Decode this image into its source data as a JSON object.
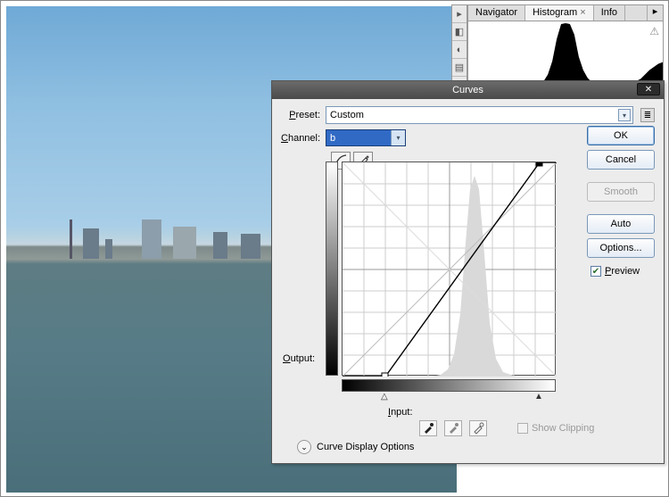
{
  "panels": {
    "tabs": {
      "navigator": "Navigator",
      "histogram": "Histogram",
      "info": "Info",
      "active": "Histogram"
    }
  },
  "dialog": {
    "title": "Curves",
    "preset_label": "Preset:",
    "preset_value": "Custom",
    "channel_label": "Channel:",
    "channel_value": "b",
    "output_label": "Output:",
    "input_label": "Input:",
    "show_clipping_label": "Show Clipping",
    "curve_display_options": "Curve Display Options",
    "buttons": {
      "ok": "OK",
      "cancel": "Cancel",
      "smooth": "Smooth",
      "auto": "Auto",
      "options": "Options..."
    },
    "preview_label": "Preview",
    "preview_checked": true
  },
  "chart_data": {
    "type": "line",
    "title": "Curves",
    "xlabel": "Input",
    "ylabel": "Output",
    "xlim": [
      0,
      255
    ],
    "ylim": [
      0,
      255
    ],
    "grid": true,
    "series": [
      {
        "name": "baseline",
        "x": [
          0,
          255
        ],
        "y": [
          0,
          255
        ]
      },
      {
        "name": "curve",
        "x": [
          0,
          51,
          235,
          255
        ],
        "y": [
          0,
          0,
          255,
          255
        ]
      }
    ],
    "control_points": [
      {
        "x": 51,
        "y": 0
      },
      {
        "x": 235,
        "y": 255
      }
    ],
    "histogram_bins_normalized": [
      0,
      0,
      0,
      0,
      0,
      0,
      0,
      0,
      0,
      0,
      0,
      0,
      0,
      0,
      0,
      0,
      0,
      0.02,
      0.05,
      0.1,
      0.2,
      0.4,
      0.7,
      1,
      0.55,
      0.25,
      0.1,
      0.05,
      0.02,
      0.01,
      0,
      0
    ],
    "input_slider_black": 51,
    "input_slider_white": 235
  }
}
